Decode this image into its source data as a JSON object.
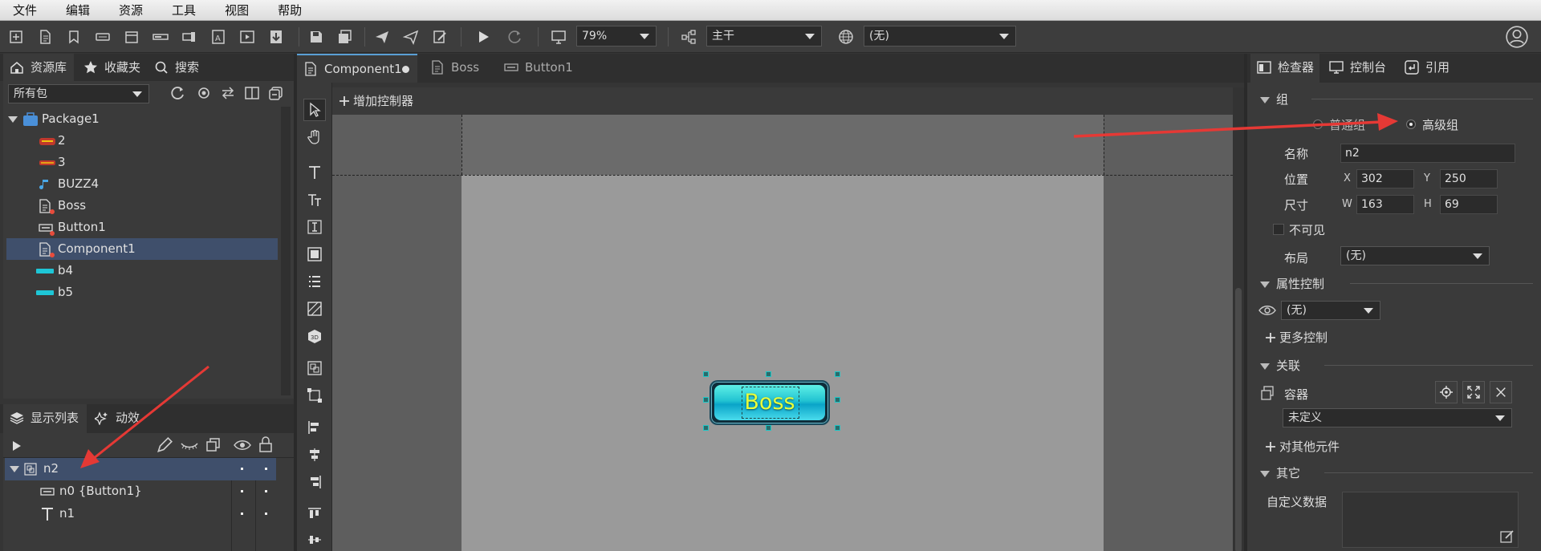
{
  "menu": [
    "文件",
    "编辑",
    "资源",
    "工具",
    "视图",
    "帮助"
  ],
  "toolbar": {
    "zoom": "79%",
    "branch": "主干",
    "language": "(无)"
  },
  "left": {
    "tabs": [
      "资源库",
      "收藏夹",
      "搜索"
    ],
    "filter": "所有包",
    "tree": {
      "package": "Package1",
      "items": [
        "2",
        "3",
        "BUZZ4",
        "Boss",
        "Button1",
        "Component1",
        "b4",
        "b5"
      ],
      "selected": "Component1"
    },
    "bottom_tabs": [
      "显示列表",
      "动效"
    ],
    "display_list": [
      {
        "name": "n2",
        "selected": true
      },
      {
        "name": "n0 {Button1}",
        "selected": false
      },
      {
        "name": "n1",
        "selected": false
      }
    ]
  },
  "editor": {
    "tabs": [
      "Component1",
      "Boss",
      "Button1"
    ],
    "active_tab": "Component1",
    "add_controller": "增加控制器",
    "button_text": "Boss"
  },
  "inspector": {
    "tabs": [
      "检查器",
      "控制台",
      "引用"
    ],
    "group_section": "组",
    "radio_normal": "普通组",
    "radio_advanced": "高级组",
    "name_label": "名称",
    "name_value": "n2",
    "pos_label": "位置",
    "x_label": "X",
    "x_value": "302",
    "y_label": "Y",
    "y_value": "250",
    "size_label": "尺寸",
    "w_label": "W",
    "w_value": "163",
    "h_label": "H",
    "h_value": "69",
    "invisible_label": "不可见",
    "layout_label": "布局",
    "layout_value": "(无)",
    "prop_section": "属性控制",
    "prop_value": "(无)",
    "more_control": "更多控制",
    "relation_section": "关联",
    "container_label": "容器",
    "undefined_value": "未定义",
    "other_elements": "对其他元件",
    "other_section": "其它",
    "custom_data_label": "自定义数据"
  },
  "colors": {
    "accent_cyan": "#1ec6c6",
    "arrow_red": "#e53935",
    "selection": "#3f4f6b",
    "boss_text": "#e8ff3a"
  }
}
